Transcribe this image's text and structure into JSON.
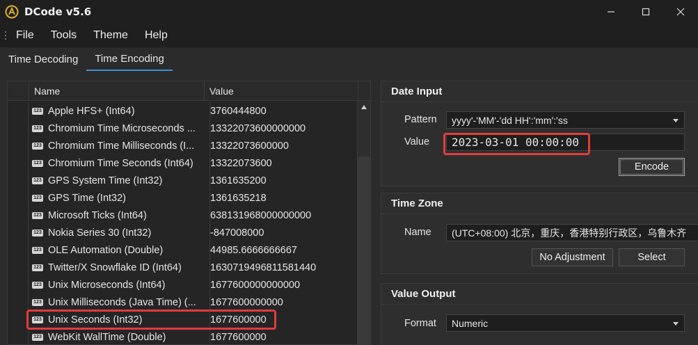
{
  "window": {
    "title": "DCode v5.6"
  },
  "menu": [
    "File",
    "Tools",
    "Theme",
    "Help"
  ],
  "tabs": [
    {
      "label": "Time Decoding",
      "active": false
    },
    {
      "label": "Time Encoding",
      "active": true
    }
  ],
  "grid": {
    "headers": {
      "name": "Name",
      "value": "Value"
    },
    "rows": [
      {
        "name": "Apple HFS+ (Int64)",
        "value": "3760444800"
      },
      {
        "name": "Chromium Time Microseconds ...",
        "value": "13322073600000000"
      },
      {
        "name": "Chromium Time Milliseconds (I...",
        "value": "13322073600000"
      },
      {
        "name": "Chromium Time Seconds (Int64)",
        "value": "13322073600"
      },
      {
        "name": "GPS System Time (Int32)",
        "value": "1361635200"
      },
      {
        "name": "GPS Time (Int32)",
        "value": "1361635218"
      },
      {
        "name": "Microsoft Ticks (Int64)",
        "value": "638131968000000000"
      },
      {
        "name": "Nokia Series 30 (Int32)",
        "value": "-847008000"
      },
      {
        "name": "OLE Automation (Double)",
        "value": "44985.6666666667"
      },
      {
        "name": "Twitter/X Snowflake ID (Int64)",
        "value": "1630719496811581440"
      },
      {
        "name": "Unix Microseconds (Int64)",
        "value": "1677600000000000"
      },
      {
        "name": "Unix Milliseconds (Java Time) (...",
        "value": "1677600000000"
      },
      {
        "name": "Unix Seconds (Int32)",
        "value": "1677600000"
      },
      {
        "name": "WebKit WallTime (Double)",
        "value": "1677600000"
      }
    ]
  },
  "date_input": {
    "title": "Date Input",
    "pattern_label": "Pattern",
    "pattern_value": "yyyy'-'MM'-'dd HH':'mm':'ss",
    "value_label": "Value",
    "value": "2023-03-01 00:00:00",
    "encode_label": "Encode"
  },
  "time_zone": {
    "title": "Time Zone",
    "name_label": "Name",
    "name_value": "(UTC+08:00) 北京，重庆，香港特别行政区，乌鲁木齐",
    "no_adjustment_label": "No Adjustment",
    "select_label": "Select"
  },
  "value_output": {
    "title": "Value Output",
    "format_label": "Format",
    "format_value": "Numeric"
  },
  "colors": {
    "highlight": "#e03c3c",
    "accent": "#3f8fd8"
  }
}
